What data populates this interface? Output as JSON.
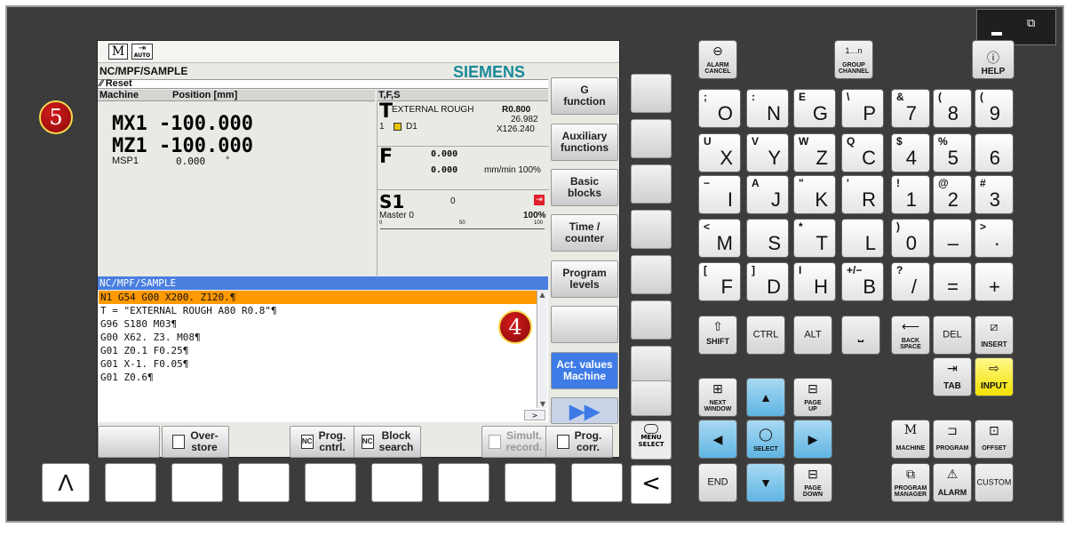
{
  "window": {
    "minimize": "▬",
    "restore": "🗗"
  },
  "screen": {
    "mode_icon_m": "M",
    "mode_icon_auto": "AUTO",
    "path": "NC/MPF/SAMPLE",
    "brand": "SIEMENS",
    "status": "Reset",
    "machine_header": "Machine",
    "position_header": "Position [mm]",
    "tfs_header": "T,F,S",
    "axes": [
      {
        "name": "MX1",
        "value": "-100.000"
      },
      {
        "name": "MZ1",
        "value": "-100.000"
      }
    ],
    "spindle_pos": {
      "name": "MSP1",
      "value": "0.000",
      "unit": "°"
    },
    "tool": {
      "letter": "T",
      "name": "EXTERNAL ROUGH",
      "radius": "R0.800",
      "val2": "26.982",
      "val3": "X126.240",
      "num": "1",
      "d": "D1"
    },
    "feed": {
      "letter": "F",
      "val1": "0.000",
      "val2": "0.000",
      "unit": "mm/min 100%"
    },
    "spindle": {
      "name": "S1",
      "value": "0",
      "label": "Master 0",
      "pct": "100%",
      "scale": [
        "0",
        "50",
        "100"
      ]
    },
    "program_title": "NC/MPF/SAMPLE",
    "program_lines": [
      "N1 G54 G00 X200. Z120.¶",
      "T = \"EXTERNAL ROUGH A80 R0.8\"¶",
      "G96 S180 M03¶",
      "G00 X62. Z3. M08¶",
      "G01 Z0.1 F0.25¶",
      "G01 X-1. F0.05¶",
      "G01 Z0.6¶"
    ],
    "vsoftkeys": [
      [
        "G",
        "function"
      ],
      [
        "Auxiliary",
        "functions"
      ],
      [
        "Basic",
        "blocks"
      ],
      [
        "Time /",
        "counter"
      ],
      [
        "Program",
        "levels"
      ],
      [
        "",
        ""
      ],
      [
        "Act. values",
        "Machine"
      ],
      [
        "▶▶",
        ""
      ]
    ],
    "hsoftkeys": [
      [
        "",
        ""
      ],
      [
        "Over-",
        "store"
      ],
      [
        "Prog.",
        "cntrl."
      ],
      [
        "Block",
        "search"
      ],
      [
        "Simult.",
        "record."
      ],
      [
        "Prog.",
        "corr."
      ]
    ]
  },
  "badges": [
    "5",
    "4"
  ],
  "panel": {
    "menu_select": [
      "MENU",
      "SELECT"
    ],
    "back": "<",
    "up": "Λ",
    "alarm_cancel": [
      "ALARM",
      "CANCEL"
    ],
    "group_channel": [
      "GROUP",
      "CHANNEL"
    ],
    "help": "HELP",
    "help_glyph": "i",
    "alpha": [
      [
        "O",
        ";"
      ],
      [
        "N",
        ":"
      ],
      [
        "G",
        "E"
      ],
      [
        "P",
        "\\"
      ],
      [
        "X",
        "U"
      ],
      [
        "Y",
        "V"
      ],
      [
        "Z",
        "W"
      ],
      [
        "C",
        "Q"
      ],
      [
        "I",
        "−"
      ],
      [
        "J",
        "A"
      ],
      [
        "K",
        "\""
      ],
      [
        "R",
        "'"
      ],
      [
        "M",
        "<"
      ],
      [
        "S",
        ""
      ],
      [
        "T",
        "*"
      ],
      [
        "L",
        ""
      ],
      [
        "F",
        "["
      ],
      [
        "D",
        "]"
      ],
      [
        "H",
        "I"
      ],
      [
        "B",
        "+/−"
      ]
    ],
    "num": [
      [
        "7",
        "&"
      ],
      [
        "8",
        "("
      ],
      [
        "9",
        "("
      ],
      [
        "4",
        "$"
      ],
      [
        "5",
        "%"
      ],
      [
        "6",
        ""
      ],
      [
        "1",
        "!"
      ],
      [
        "2",
        "@"
      ],
      [
        "3",
        "#"
      ],
      [
        "0",
        ")"
      ],
      [
        "–",
        ""
      ],
      [
        "·",
        ">"
      ],
      [
        "/",
        "?"
      ],
      [
        "=",
        ""
      ],
      [
        "+",
        ""
      ]
    ],
    "edit": {
      "shift": "SHIFT",
      "ctrl": "CTRL",
      "alt": "ALT",
      "backspace": [
        "BACK",
        "SPACE"
      ],
      "del": "DEL",
      "insert": "INSERT",
      "tab": "TAB",
      "input": "INPUT"
    },
    "nav": {
      "next_window": [
        "NEXT",
        "WINDOW"
      ],
      "page_up": [
        "PAGE",
        "UP"
      ],
      "select": "SELECT",
      "end": "END",
      "page_down": [
        "PAGE",
        "DOWN"
      ]
    },
    "area": {
      "machine": "MACHINE",
      "program": "PROGRAM",
      "offset": "OFFSET",
      "program_manager": [
        "PROGRAM",
        "MANAGER"
      ],
      "alarm": "ALARM",
      "custom": "CUSTOM"
    },
    "colors": {
      "blue_key": "#5fb5e3",
      "yellow_key": "#f3e100",
      "highlight": "#ff9900",
      "selected_softkey": "#3e7be6"
    }
  }
}
